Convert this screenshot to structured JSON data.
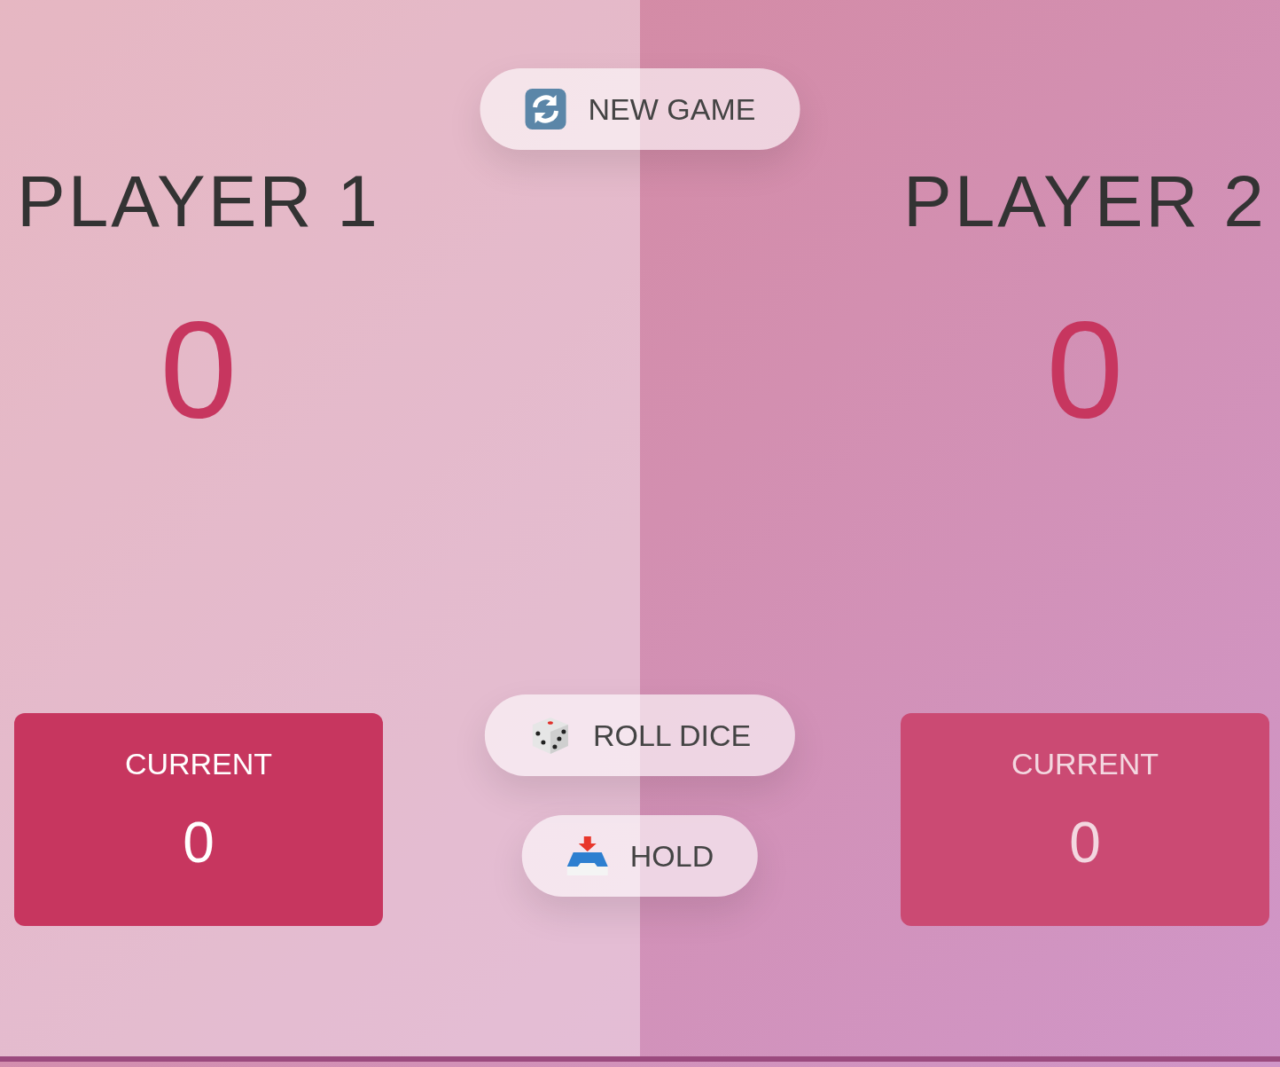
{
  "players": [
    {
      "name": "PLAYER 1",
      "score": "0",
      "current_label": "CURRENT",
      "current": "0",
      "active": true
    },
    {
      "name": "PLAYER 2",
      "score": "0",
      "current_label": "CURRENT",
      "current": "0",
      "active": false
    }
  ],
  "buttons": [
    {
      "kind": "new",
      "label": "NEW GAME"
    },
    {
      "kind": "roll",
      "label": "ROLL DICE"
    },
    {
      "kind": "hold",
      "label": "HOLD"
    }
  ]
}
